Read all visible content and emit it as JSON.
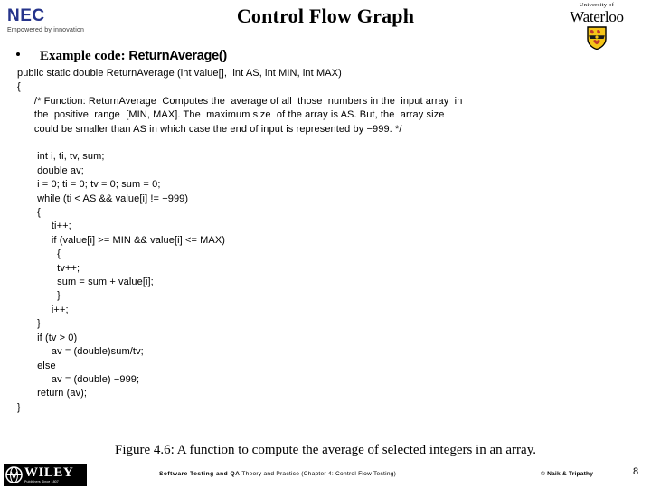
{
  "header": {
    "title": "Control Flow Graph",
    "nec_logo": {
      "wordmark": "NEC",
      "tagline": "Empowered by innovation",
      "color": "#26348b"
    },
    "waterloo_logo": {
      "line1": "University of",
      "line2": "Waterloo",
      "shield_color": "#f5c518"
    }
  },
  "bullet": {
    "label": "Example code:",
    "function_name": "ReturnAverage()"
  },
  "code": {
    "lines": [
      "public static double ReturnAverage (int value[],  int AS, int MIN, int MAX)",
      "{",
      "      /* Function: ReturnAverage  Computes the  average of all  those  numbers in the  input array  in",
      "      the  positive  range  [MIN, MAX]. The  maximum size  of the array is AS. But, the  array size",
      "      could be smaller than AS in which case the end of input is represented by −999. */",
      "",
      "       int i, ti, tv, sum;",
      "       double av;",
      "       i = 0; ti = 0; tv = 0; sum = 0;",
      "       while (ti < AS && value[i] != −999)",
      "       {",
      "            ti++;",
      "            if (value[i] >= MIN && value[i] <= MAX)",
      "              {",
      "              tv++;",
      "              sum = sum + value[i];",
      "              }",
      "            i++;",
      "       }",
      "       if (tv > 0)",
      "            av = (double)sum/tv;",
      "       else",
      "            av = (double) −999;",
      "       return (av);",
      "}"
    ]
  },
  "caption": {
    "text": "Figure 4.6: A function to compute the average of selected integers in an array."
  },
  "footer": {
    "wiley_logo": {
      "word": "WILEY",
      "tagline": "Publishers Since 1807"
    },
    "book_title_bold": "Software Testing and QA",
    "book_subtitle": " Theory and Practice (Chapter 4: Control Flow Testing)",
    "copyright": "© Naik & Tripathy",
    "page_number": "8"
  }
}
